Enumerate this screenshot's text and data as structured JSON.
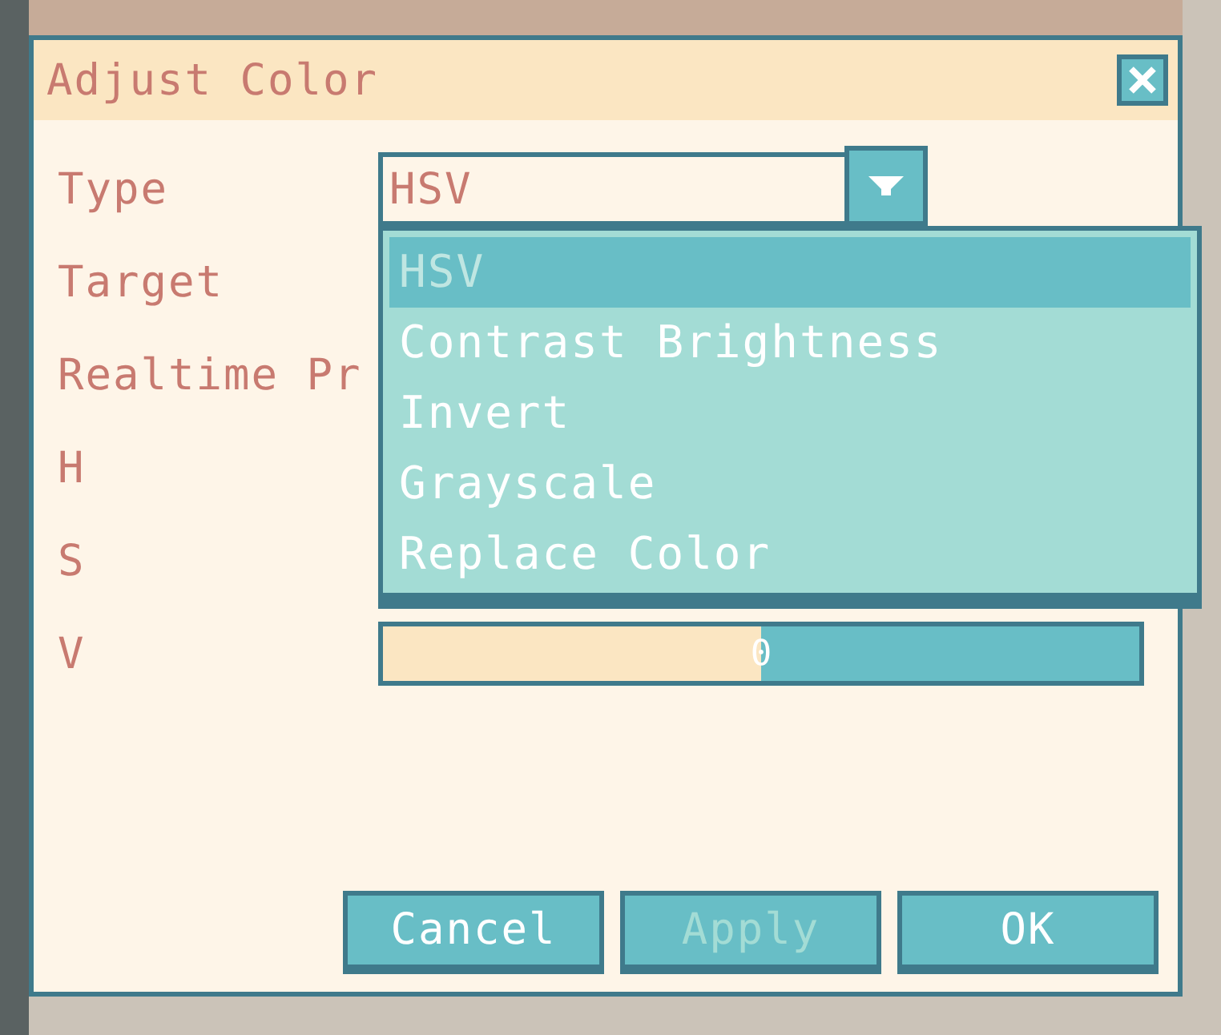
{
  "dialog": {
    "title": "Adjust Color",
    "fields": [
      {
        "kind": "combo",
        "label": "Type",
        "value": "HSV",
        "expanded": true,
        "options": [
          {
            "label": "HSV",
            "selected": true
          },
          {
            "label": "Contrast Brightness",
            "selected": false
          },
          {
            "label": "Invert",
            "selected": false
          },
          {
            "label": "Grayscale",
            "selected": false
          },
          {
            "label": "Replace Color",
            "selected": false
          }
        ]
      },
      {
        "kind": "label",
        "label": "Target"
      },
      {
        "kind": "label",
        "label": "Realtime Pr"
      },
      {
        "kind": "label",
        "label": "H"
      },
      {
        "kind": "label",
        "label": "S"
      },
      {
        "kind": "slider",
        "label": "V",
        "level": 0.5,
        "reading": "0"
      }
    ],
    "buttons": [
      {
        "label": "Cancel",
        "disabled": false
      },
      {
        "label": "Apply",
        "disabled": true
      },
      {
        "label": "OK",
        "disabled": false
      }
    ]
  }
}
